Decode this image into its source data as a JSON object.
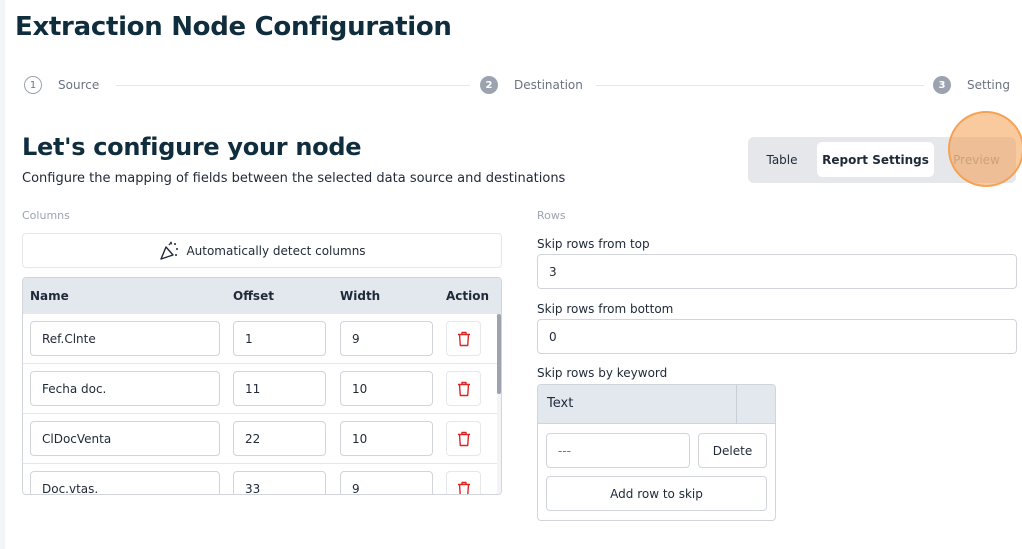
{
  "page_title": "Extraction Node Configuration",
  "stepper": [
    {
      "number": "1",
      "label": "Source"
    },
    {
      "number": "2",
      "label": "Destination"
    },
    {
      "number": "3",
      "label": "Setting"
    }
  ],
  "heading": "Let's configure your node",
  "subheading": "Configure the mapping of fields between the selected data source and destinations",
  "tabs": [
    {
      "label": "Table"
    },
    {
      "label": "Report Settings"
    },
    {
      "label": "Preview"
    }
  ],
  "active_tab": "Report Settings",
  "columns": {
    "section_label": "Columns",
    "auto_detect_label": "Automatically detect columns",
    "headers": {
      "name": "Name",
      "offset": "Offset",
      "width": "Width",
      "action": "Action"
    },
    "rows": [
      {
        "name": "Ref.Clnte",
        "offset": "1",
        "width": "9"
      },
      {
        "name": "Fecha doc.",
        "offset": "11",
        "width": "10"
      },
      {
        "name": "ClDocVenta",
        "offset": "22",
        "width": "10"
      },
      {
        "name": "Doc.vtas.",
        "offset": "33",
        "width": "9"
      }
    ]
  },
  "rows": {
    "section_label": "Rows",
    "skip_top_label": "Skip rows from top",
    "skip_top_value": "3",
    "skip_bottom_label": "Skip rows from bottom",
    "skip_bottom_value": "0",
    "skip_keyword_label": "Skip rows by keyword",
    "keyword_table": {
      "header": "Text",
      "rows": [
        {
          "value": "---",
          "delete_label": "Delete"
        }
      ],
      "add_label": "Add row to skip"
    }
  },
  "colors": {
    "title": "#0f2d3d",
    "highlight": "#f59e50",
    "trash": "#dc2626"
  }
}
